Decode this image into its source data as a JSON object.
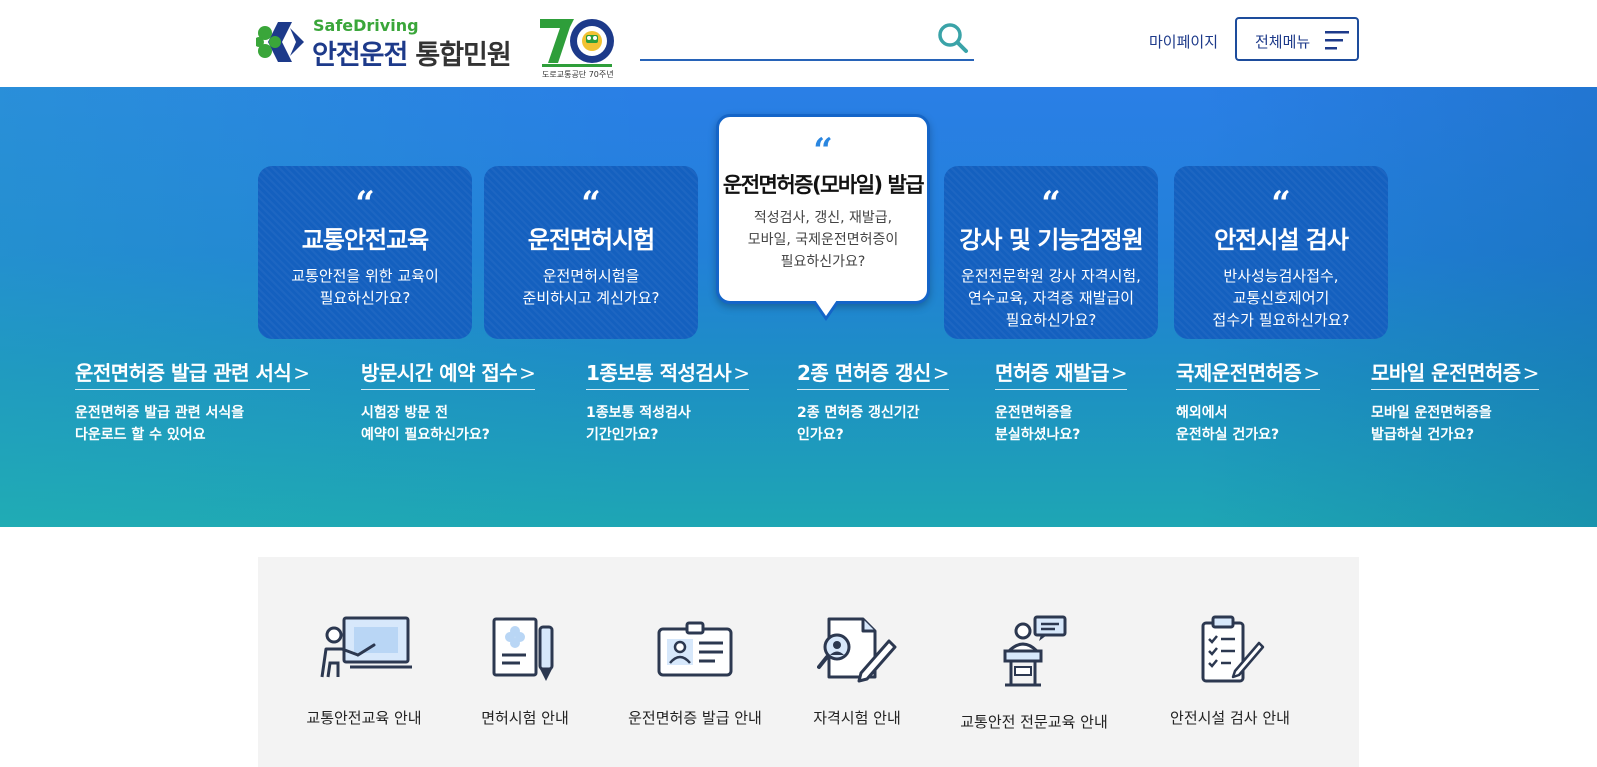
{
  "header": {
    "logo_sub": "SafeDriving",
    "logo_main": "안전운전",
    "logo_main_2": "통합민원",
    "logo_anniv_caption": "도로교통공단 70주년",
    "search_placeholder": "",
    "mypage_label": "마이페이지",
    "allmenu_label": "전체메뉴"
  },
  "colors": {
    "brand_navy": "#1d3a8a",
    "brand_green": "#3aa63a",
    "card_blue": "#1460bf",
    "accent_blue": "#2a86e0",
    "hero_top": "#2a7fe6",
    "hero_bottom": "#1ea6b4",
    "panel_bg": "#f3f3f3"
  },
  "cards": [
    {
      "title": "교통안전교육",
      "desc1": "교통안전을 위한 교육이",
      "desc2": "필요하신가요?",
      "desc3": ""
    },
    {
      "title": "운전면허시험",
      "desc1": "운전면허시험을",
      "desc2": "준비하시고 계신가요?",
      "desc3": ""
    },
    {
      "title": "운전면허증(모바일) 발급",
      "desc1": "적성검사, 갱신, 재발급,",
      "desc2": "모바일, 국제운전면허증이",
      "desc3": "필요하신가요?"
    },
    {
      "title": "강사 및 기능검정원",
      "desc1": "운전전문학원 강사 자격시험,",
      "desc2": "연수교육, 자격증 재발급이",
      "desc3": "필요하신가요?"
    },
    {
      "title": "안전시설 검사",
      "desc1": "반사성능검사접수,",
      "desc2": "교통신호제어기",
      "desc3": "접수가 필요하신가요?"
    }
  ],
  "quote_mark": "“",
  "arrow": ">",
  "sublinks": [
    {
      "title": "운전면허증 발급 관련 서식",
      "desc1": "운전면허증 발급 관련 서식을",
      "desc2": "다운로드 할 수 있어요"
    },
    {
      "title": "방문시간 예약 접수",
      "desc1": "시험장 방문 전",
      "desc2": "예약이 필요하신가요?"
    },
    {
      "title": "1종보통 적성검사",
      "desc1": "1종보통 적성검사",
      "desc2": "기간인가요?"
    },
    {
      "title": "2종 면허증 갱신",
      "desc1": "2종 면허증 갱신기간",
      "desc2": "인가요?"
    },
    {
      "title": "면허증 재발급",
      "desc1": "운전면허증을",
      "desc2": "분실하셨나요?"
    },
    {
      "title": "국제운전면허증",
      "desc1": "해외에서",
      "desc2": "운전하실 건가요?"
    },
    {
      "title": "모바일 운전면허증",
      "desc1": "모바일 운전면허증을",
      "desc2": "발급하실 건가요?"
    }
  ],
  "services": [
    {
      "label": "교통안전교육 안내",
      "icon": "teacher-board-icon"
    },
    {
      "label": "면허시험 안내",
      "icon": "document-pen-icon"
    },
    {
      "label": "운전면허증 발급 안내",
      "icon": "id-card-icon"
    },
    {
      "label": "자격시험 안내",
      "icon": "search-document-pen-icon"
    },
    {
      "label": "교통안전 전문교육 안내",
      "icon": "podium-speaker-icon"
    },
    {
      "label": "안전시설 검사 안내",
      "icon": "clipboard-checklist-icon"
    }
  ]
}
